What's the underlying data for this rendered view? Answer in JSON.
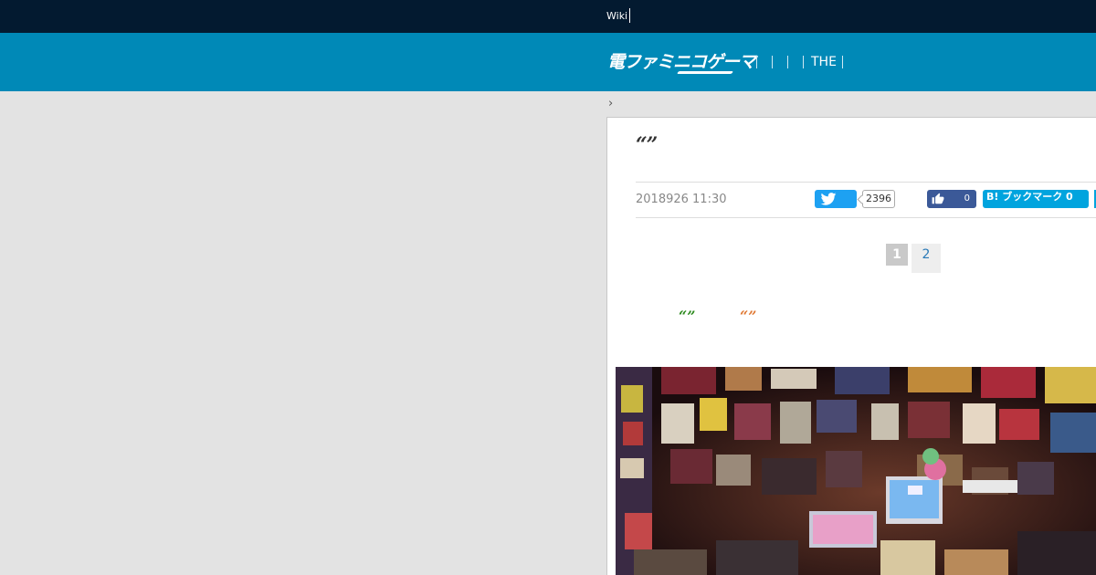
{
  "topbar": {
    "wiki_label": "Wiki"
  },
  "header": {
    "logo_text": "電ファミニコゲーマ",
    "nav_item_the": "THE"
  },
  "breadcrumb": {
    "chevron": "›"
  },
  "article": {
    "title": "“”",
    "date": "2018926 11:30",
    "share": {
      "twitter_count": "2396",
      "facebook_count": "0",
      "hatena_label": "B! ブックマーク 0"
    },
    "pagination": {
      "current": "1",
      "next": "2"
    },
    "quote_green": "“”",
    "quote_orange": "“”"
  },
  "colors": {
    "topbar": "#031a30",
    "header": "#0089b7",
    "twitter": "#1da1f2",
    "facebook": "#3b5998",
    "hatena": "#00a4de",
    "quote_green": "#2d8a1e",
    "quote_orange": "#e07a35"
  },
  "icons": [
    "twitter-bird-icon",
    "thumbs-up-icon",
    "chevron-right-icon"
  ]
}
